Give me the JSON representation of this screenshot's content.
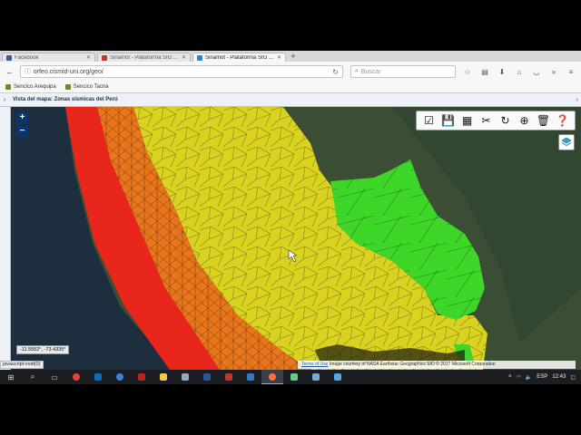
{
  "browser": {
    "tabs": [
      {
        "label": "Facebook",
        "color": "#3b5998",
        "active": false
      },
      {
        "label": "Sinamot - Plataforma SIG ...",
        "color": "#c0392b",
        "active": false
      },
      {
        "label": "Sinamot - Plataforma SIG ...",
        "color": "#2e86c1",
        "active": true
      }
    ],
    "url": "orfeo.cismid-uni.org/geo/",
    "search_placeholder": "Buscar",
    "bookmarks": [
      "Sencico Arequipa",
      "Sencico Tacna"
    ]
  },
  "app": {
    "header_title": "Vista del mapa: Zonas sísmicas del Perú"
  },
  "map": {
    "zoom_in": "+",
    "zoom_out": "−",
    "coordinates": "-11.5552°, -73.4335°",
    "attribution_terms": "Terms of Use",
    "attribution_text": "Image courtesy of NASA Earthstar Geographics SIO © 2017 Microsoft Corporation",
    "status_link": "javascript:void(0)",
    "zone_colors": {
      "zone4": "#e8261c",
      "zone3": "#e9761a",
      "zone2": "#d9d320",
      "zone1": "#3fd62a",
      "sea": "#1d2f3f",
      "land": "#3b4d33"
    },
    "toolbar_icons": [
      "checkbox-icon",
      "save-icon",
      "print-icon",
      "measure-icon",
      "refresh-icon",
      "add-layer-icon",
      "delete-icon",
      "help-icon"
    ]
  },
  "taskbar": {
    "clock": "12:43",
    "language": "ESP"
  }
}
